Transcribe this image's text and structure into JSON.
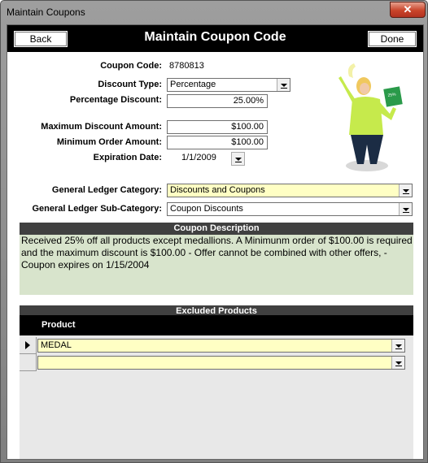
{
  "window": {
    "title": "Maintain Coupons",
    "close_label": "✕"
  },
  "header": {
    "back_label": "Back",
    "title": "Maintain Coupon Code",
    "done_label": "Done"
  },
  "form": {
    "coupon_code_label": "Coupon Code:",
    "coupon_code": "8780813",
    "discount_type_label": "Discount Type:",
    "discount_type": "Percentage",
    "percentage_discount_label": "Percentage Discount:",
    "percentage_discount": "25.00%",
    "max_discount_label": "Maximum Discount Amount:",
    "max_discount": "$100.00",
    "min_order_label": "Minimum Order Amount:",
    "min_order": "$100.00",
    "expiration_label": "Expiration Date:",
    "expiration": "1/1/2009",
    "gl_category_label": "General Ledger Category:",
    "gl_category": "Discounts and Coupons",
    "gl_subcategory_label": "General Ledger Sub-Category:",
    "gl_subcategory": "Coupon Discounts"
  },
  "description": {
    "header": "Coupon Description",
    "text": "Received 25% off all products except medallions.  A Minimunm order of $100.00 is required and the maximum discount is $100.00 - Offer cannot be combined with other offers, -  Coupon expires on 1/15/2004"
  },
  "excluded": {
    "header": "Excluded Products",
    "column": "Product",
    "rows": [
      {
        "product": "MEDAL"
      },
      {
        "product": ""
      }
    ]
  },
  "icons": {
    "dropdown": "dropdown-arrow-icon",
    "row_selector": "record-pointer-icon",
    "close": "close-icon"
  }
}
